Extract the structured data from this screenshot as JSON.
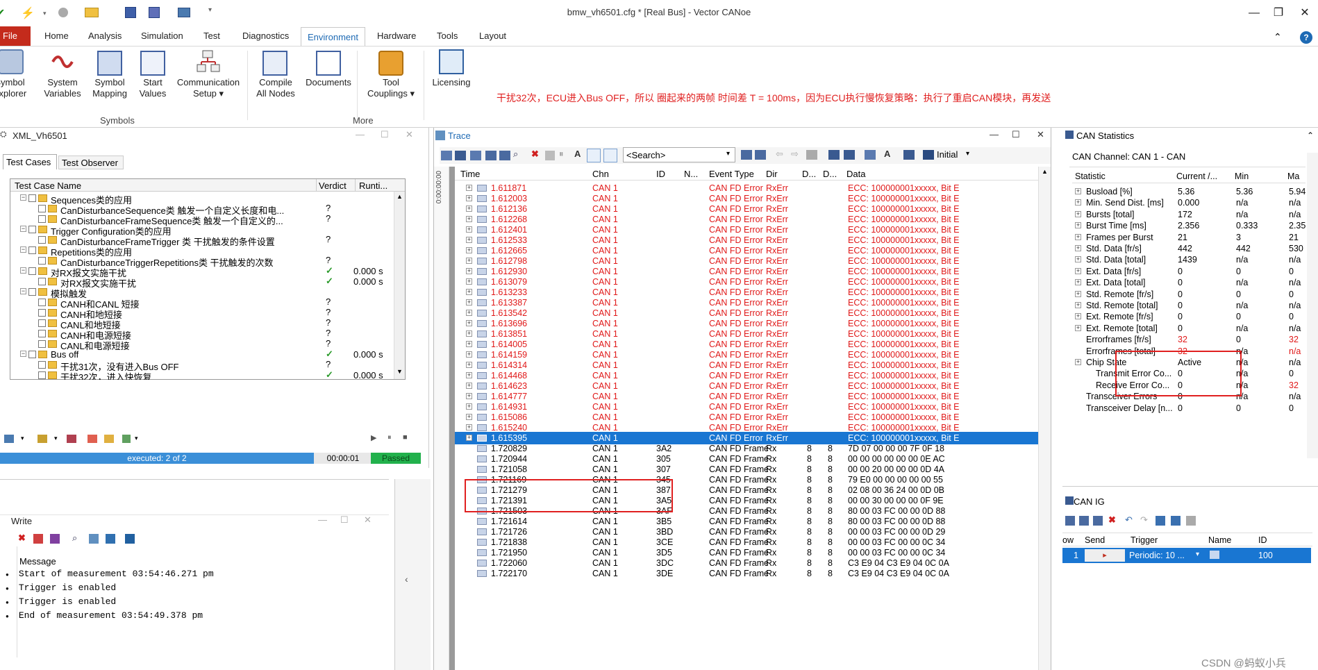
{
  "window": {
    "title": "bmw_vh6501.cfg * [Real Bus] - Vector CANoe"
  },
  "menu": [
    "File",
    "Home",
    "Analysis",
    "Simulation",
    "Test",
    "Diagnostics",
    "Environment",
    "Hardware",
    "Tools",
    "Layout"
  ],
  "ribbon": {
    "buttons": [
      {
        "l1": "Symbol",
        "l2": "Explorer"
      },
      {
        "l1": "System",
        "l2": "Variables"
      },
      {
        "l1": "Symbol",
        "l2": "Mapping"
      },
      {
        "l1": "Start",
        "l2": "Values"
      },
      {
        "l1": "Communication",
        "l2": "Setup ▾"
      },
      {
        "l1": "Compile",
        "l2": "All Nodes"
      },
      {
        "l1": "Documents",
        "l2": ""
      },
      {
        "l1": "Tool",
        "l2": "Couplings ▾"
      },
      {
        "l1": "Licensing",
        "l2": ""
      }
    ],
    "groups": [
      "Symbols",
      "More"
    ],
    "note": "干扰32次，ECU进入Bus OFF，所以 圈起来的两帧 时间差 T = 100ms，因为ECU执行慢恢复策略：执行了重启CAN模块，再发送"
  },
  "testpanel": {
    "title": "XML_Vh6501",
    "tabs": [
      "Test Cases",
      "Test Observer"
    ],
    "columns": [
      "Test Case Name",
      "Verdict",
      "Runti..."
    ],
    "items": [
      {
        "label": "Sequences类的应用",
        "level": 0,
        "verdict": "",
        "time": ""
      },
      {
        "label": "CanDisturbanceSequence类 触发一个自定义长度和电...",
        "level": 1,
        "verdict": "?",
        "time": ""
      },
      {
        "label": "CanDisturbanceFrameSequence类 触发一个自定义的...",
        "level": 1,
        "verdict": "?",
        "time": ""
      },
      {
        "label": "Trigger Configuration类的应用",
        "level": 0,
        "verdict": "",
        "time": ""
      },
      {
        "label": "CanDisturbanceFrameTrigger 类 干扰触发的条件设置",
        "level": 1,
        "verdict": "?",
        "time": ""
      },
      {
        "label": "Repetitions类的应用",
        "level": 0,
        "verdict": "",
        "time": ""
      },
      {
        "label": "CanDisturbanceTriggerRepetitions类 干扰触发的次数",
        "level": 1,
        "verdict": "?",
        "time": ""
      },
      {
        "label": "对RX报文实施干扰",
        "level": 0,
        "verdict": "✓",
        "time": "0.000 s"
      },
      {
        "label": "对RX报文实施干扰",
        "level": 1,
        "verdict": "✓",
        "time": "0.000 s"
      },
      {
        "label": "模拟触发",
        "level": 0,
        "verdict": "",
        "time": ""
      },
      {
        "label": "CANH和CANL 短接",
        "level": 1,
        "verdict": "?",
        "time": ""
      },
      {
        "label": "CANH和地短接",
        "level": 1,
        "verdict": "?",
        "time": ""
      },
      {
        "label": "CANL和地短接",
        "level": 1,
        "verdict": "?",
        "time": ""
      },
      {
        "label": "CANH和电源短接",
        "level": 1,
        "verdict": "?",
        "time": ""
      },
      {
        "label": "CANL和电源短接",
        "level": 1,
        "verdict": "?",
        "time": ""
      },
      {
        "label": "Bus off",
        "level": 0,
        "verdict": "✓",
        "time": "0.000 s"
      },
      {
        "label": "干扰31次，没有进入Bus OFF",
        "level": 1,
        "verdict": "?",
        "time": ""
      },
      {
        "label": "干扰32次，进入快恢复",
        "level": 1,
        "verdict": "✓",
        "time": "0.000 s"
      }
    ],
    "status": {
      "executed": "executed: 2 of 2",
      "time": "00:00:01",
      "result": "Passed"
    }
  },
  "write": {
    "title": "Write",
    "header": "Message",
    "lines": [
      "Start of measurement 03:54:46.271 pm",
      "Trigger is enabled",
      "Trigger is enabled",
      "End of measurement 03:54:49.378 pm"
    ]
  },
  "trace": {
    "title": "Trace",
    "search_placeholder": "<Search>",
    "layout": "Initial",
    "timeline": "0:00:00:00",
    "columns": [
      "Time",
      "Chn",
      "ID",
      "N...",
      "Event Type",
      "Dir",
      "D...",
      "D...",
      "Data"
    ],
    "error_times": [
      "1.611871",
      "1.612003",
      "1.612136",
      "1.612268",
      "1.612401",
      "1.612533",
      "1.612665",
      "1.612798",
      "1.612930",
      "1.613079",
      "1.613233",
      "1.613387",
      "1.613542",
      "1.613696",
      "1.613851",
      "1.614005",
      "1.614159",
      "1.614314",
      "1.614468",
      "1.614623",
      "1.614777",
      "1.614931",
      "1.615086",
      "1.615240"
    ],
    "error_row": {
      "chn": "CAN 1",
      "event": "CAN FD Error",
      "dir": "RxErr",
      "data": "ECC: 100000001xxxxx, Bit E"
    },
    "selected": {
      "time": "1.615395",
      "chn": "CAN 1",
      "event": "CAN FD Error",
      "dir": "RxErr",
      "data": "ECC: 100000001xxxxx, Bit E"
    },
    "frames": [
      {
        "time": "1.720829",
        "chn": "CAN 1",
        "id": "3A2",
        "event": "CAN FD Frame",
        "dir": "Rx",
        "d1": "8",
        "d2": "8",
        "data": "7D 07 00 00 00 7F 0F 18"
      },
      {
        "time": "1.720944",
        "chn": "CAN 1",
        "id": "305",
        "event": "CAN FD Frame",
        "dir": "Rx",
        "d1": "8",
        "d2": "8",
        "data": "00 00 00 00 00 00 0E AC"
      },
      {
        "time": "1.721058",
        "chn": "CAN 1",
        "id": "307",
        "event": "CAN FD Frame",
        "dir": "Rx",
        "d1": "8",
        "d2": "8",
        "data": "00 00 20 00 00 00 0D 4A"
      },
      {
        "time": "1.721169",
        "chn": "CAN 1",
        "id": "345",
        "event": "CAN FD Frame",
        "dir": "Rx",
        "d1": "8",
        "d2": "8",
        "data": "79 E0 00 00 00 00 00 55"
      },
      {
        "time": "1.721279",
        "chn": "CAN 1",
        "id": "387",
        "event": "CAN FD Frame",
        "dir": "Rx",
        "d1": "8",
        "d2": "8",
        "data": "02 08 00 36 24 00 0D 0B"
      },
      {
        "time": "1.721391",
        "chn": "CAN 1",
        "id": "3A5",
        "event": "CAN FD Frame",
        "dir": "Rx",
        "d1": "8",
        "d2": "8",
        "data": "00 00 30 00 00 00 0F 9E"
      },
      {
        "time": "1.721503",
        "chn": "CAN 1",
        "id": "3AF",
        "event": "CAN FD Frame",
        "dir": "Rx",
        "d1": "8",
        "d2": "8",
        "data": "80 00 03 FC 00 00 0D 88"
      },
      {
        "time": "1.721614",
        "chn": "CAN 1",
        "id": "3B5",
        "event": "CAN FD Frame",
        "dir": "Rx",
        "d1": "8",
        "d2": "8",
        "data": "80 00 03 FC 00 00 0D 88"
      },
      {
        "time": "1.721726",
        "chn": "CAN 1",
        "id": "3BD",
        "event": "CAN FD Frame",
        "dir": "Rx",
        "d1": "8",
        "d2": "8",
        "data": "00 00 03 FC 00 00 0D 29"
      },
      {
        "time": "1.721838",
        "chn": "CAN 1",
        "id": "3CE",
        "event": "CAN FD Frame",
        "dir": "Rx",
        "d1": "8",
        "d2": "8",
        "data": "00 00 03 FC 00 00 0C 34"
      },
      {
        "time": "1.721950",
        "chn": "CAN 1",
        "id": "3D5",
        "event": "CAN FD Frame",
        "dir": "Rx",
        "d1": "8",
        "d2": "8",
        "data": "00 00 03 FC 00 00 0C 34"
      },
      {
        "time": "1.722060",
        "chn": "CAN 1",
        "id": "3DC",
        "event": "CAN FD Frame",
        "dir": "Rx",
        "d1": "8",
        "d2": "8",
        "data": "C3 E9 04 C3 E9 04 0C 0A"
      },
      {
        "time": "1.722170",
        "chn": "CAN 1",
        "id": "3DE",
        "event": "CAN FD Frame",
        "dir": "Rx",
        "d1": "8",
        "d2": "8",
        "data": "C3 E9 04 C3 E9 04 0C 0A"
      }
    ]
  },
  "stats": {
    "title": "CAN Statistics",
    "channel_label": "CAN Channel:",
    "channel": "CAN 1 - CAN",
    "columns": [
      "Statistic",
      "Current /...",
      "Min",
      "Ma"
    ],
    "rows": [
      {
        "name": "Busload [%]",
        "cur": "5.36",
        "min": "5.36",
        "max": "5.94",
        "exp": true,
        "red": false
      },
      {
        "name": "Min. Send Dist. [ms]",
        "cur": "0.000",
        "min": "n/a",
        "max": "n/a",
        "exp": true,
        "red": false
      },
      {
        "name": "Bursts [total]",
        "cur": "172",
        "min": "n/a",
        "max": "n/a",
        "exp": true,
        "red": false
      },
      {
        "name": "Burst Time [ms]",
        "cur": "2.356",
        "min": "0.333",
        "max": "2.35",
        "exp": true,
        "red": false
      },
      {
        "name": "Frames per Burst",
        "cur": "21",
        "min": "3",
        "max": "21",
        "exp": true,
        "red": false
      },
      {
        "name": "Std. Data [fr/s]",
        "cur": "442",
        "min": "442",
        "max": "530",
        "exp": true,
        "red": false
      },
      {
        "name": "Std. Data [total]",
        "cur": "1439",
        "min": "n/a",
        "max": "n/a",
        "exp": true,
        "red": false
      },
      {
        "name": "Ext. Data [fr/s]",
        "cur": "0",
        "min": "0",
        "max": "0",
        "exp": true,
        "red": false
      },
      {
        "name": "Ext. Data [total]",
        "cur": "0",
        "min": "n/a",
        "max": "n/a",
        "exp": true,
        "red": false
      },
      {
        "name": "Std. Remote [fr/s]",
        "cur": "0",
        "min": "0",
        "max": "0",
        "exp": true,
        "red": false
      },
      {
        "name": "Std. Remote [total]",
        "cur": "0",
        "min": "n/a",
        "max": "n/a",
        "exp": true,
        "red": false
      },
      {
        "name": "Ext. Remote [fr/s]",
        "cur": "0",
        "min": "0",
        "max": "0",
        "exp": true,
        "red": false
      },
      {
        "name": "Ext. Remote [total]",
        "cur": "0",
        "min": "n/a",
        "max": "n/a",
        "exp": true,
        "red": false
      },
      {
        "name": "Errorframes [fr/s]",
        "cur": "32",
        "min": "0",
        "max": "32",
        "exp": false,
        "red": true
      },
      {
        "name": "Errorframes [total]",
        "cur": "32",
        "min": "n/a",
        "max": "n/a",
        "exp": false,
        "red": true
      },
      {
        "name": "Chip State",
        "cur": "Active",
        "min": "n/a",
        "max": "n/a",
        "exp": true,
        "red": false
      },
      {
        "name": "Transmit Error Co...",
        "cur": "0",
        "min": "n/a",
        "max": "0",
        "exp": false,
        "red": false,
        "indent": true
      },
      {
        "name": "Receive Error Co...",
        "cur": "0",
        "min": "n/a",
        "max": "32",
        "exp": false,
        "red": false,
        "indent": true,
        "redmax": true
      },
      {
        "name": "Transceiver Errors",
        "cur": "0",
        "min": "n/a",
        "max": "n/a",
        "exp": false,
        "red": false
      },
      {
        "name": "Transceiver Delay [n...",
        "cur": "0",
        "min": "0",
        "max": "0",
        "exp": false,
        "red": false
      }
    ]
  },
  "canig": {
    "title": "CAN IG",
    "columns": [
      "ow",
      "Send",
      "Trigger",
      "Name",
      "ID"
    ],
    "row": {
      "n": "1",
      "trigger": "Periodic: 10 ...",
      "id": "100"
    }
  },
  "watermark": "CSDN @蚂蚁小兵"
}
